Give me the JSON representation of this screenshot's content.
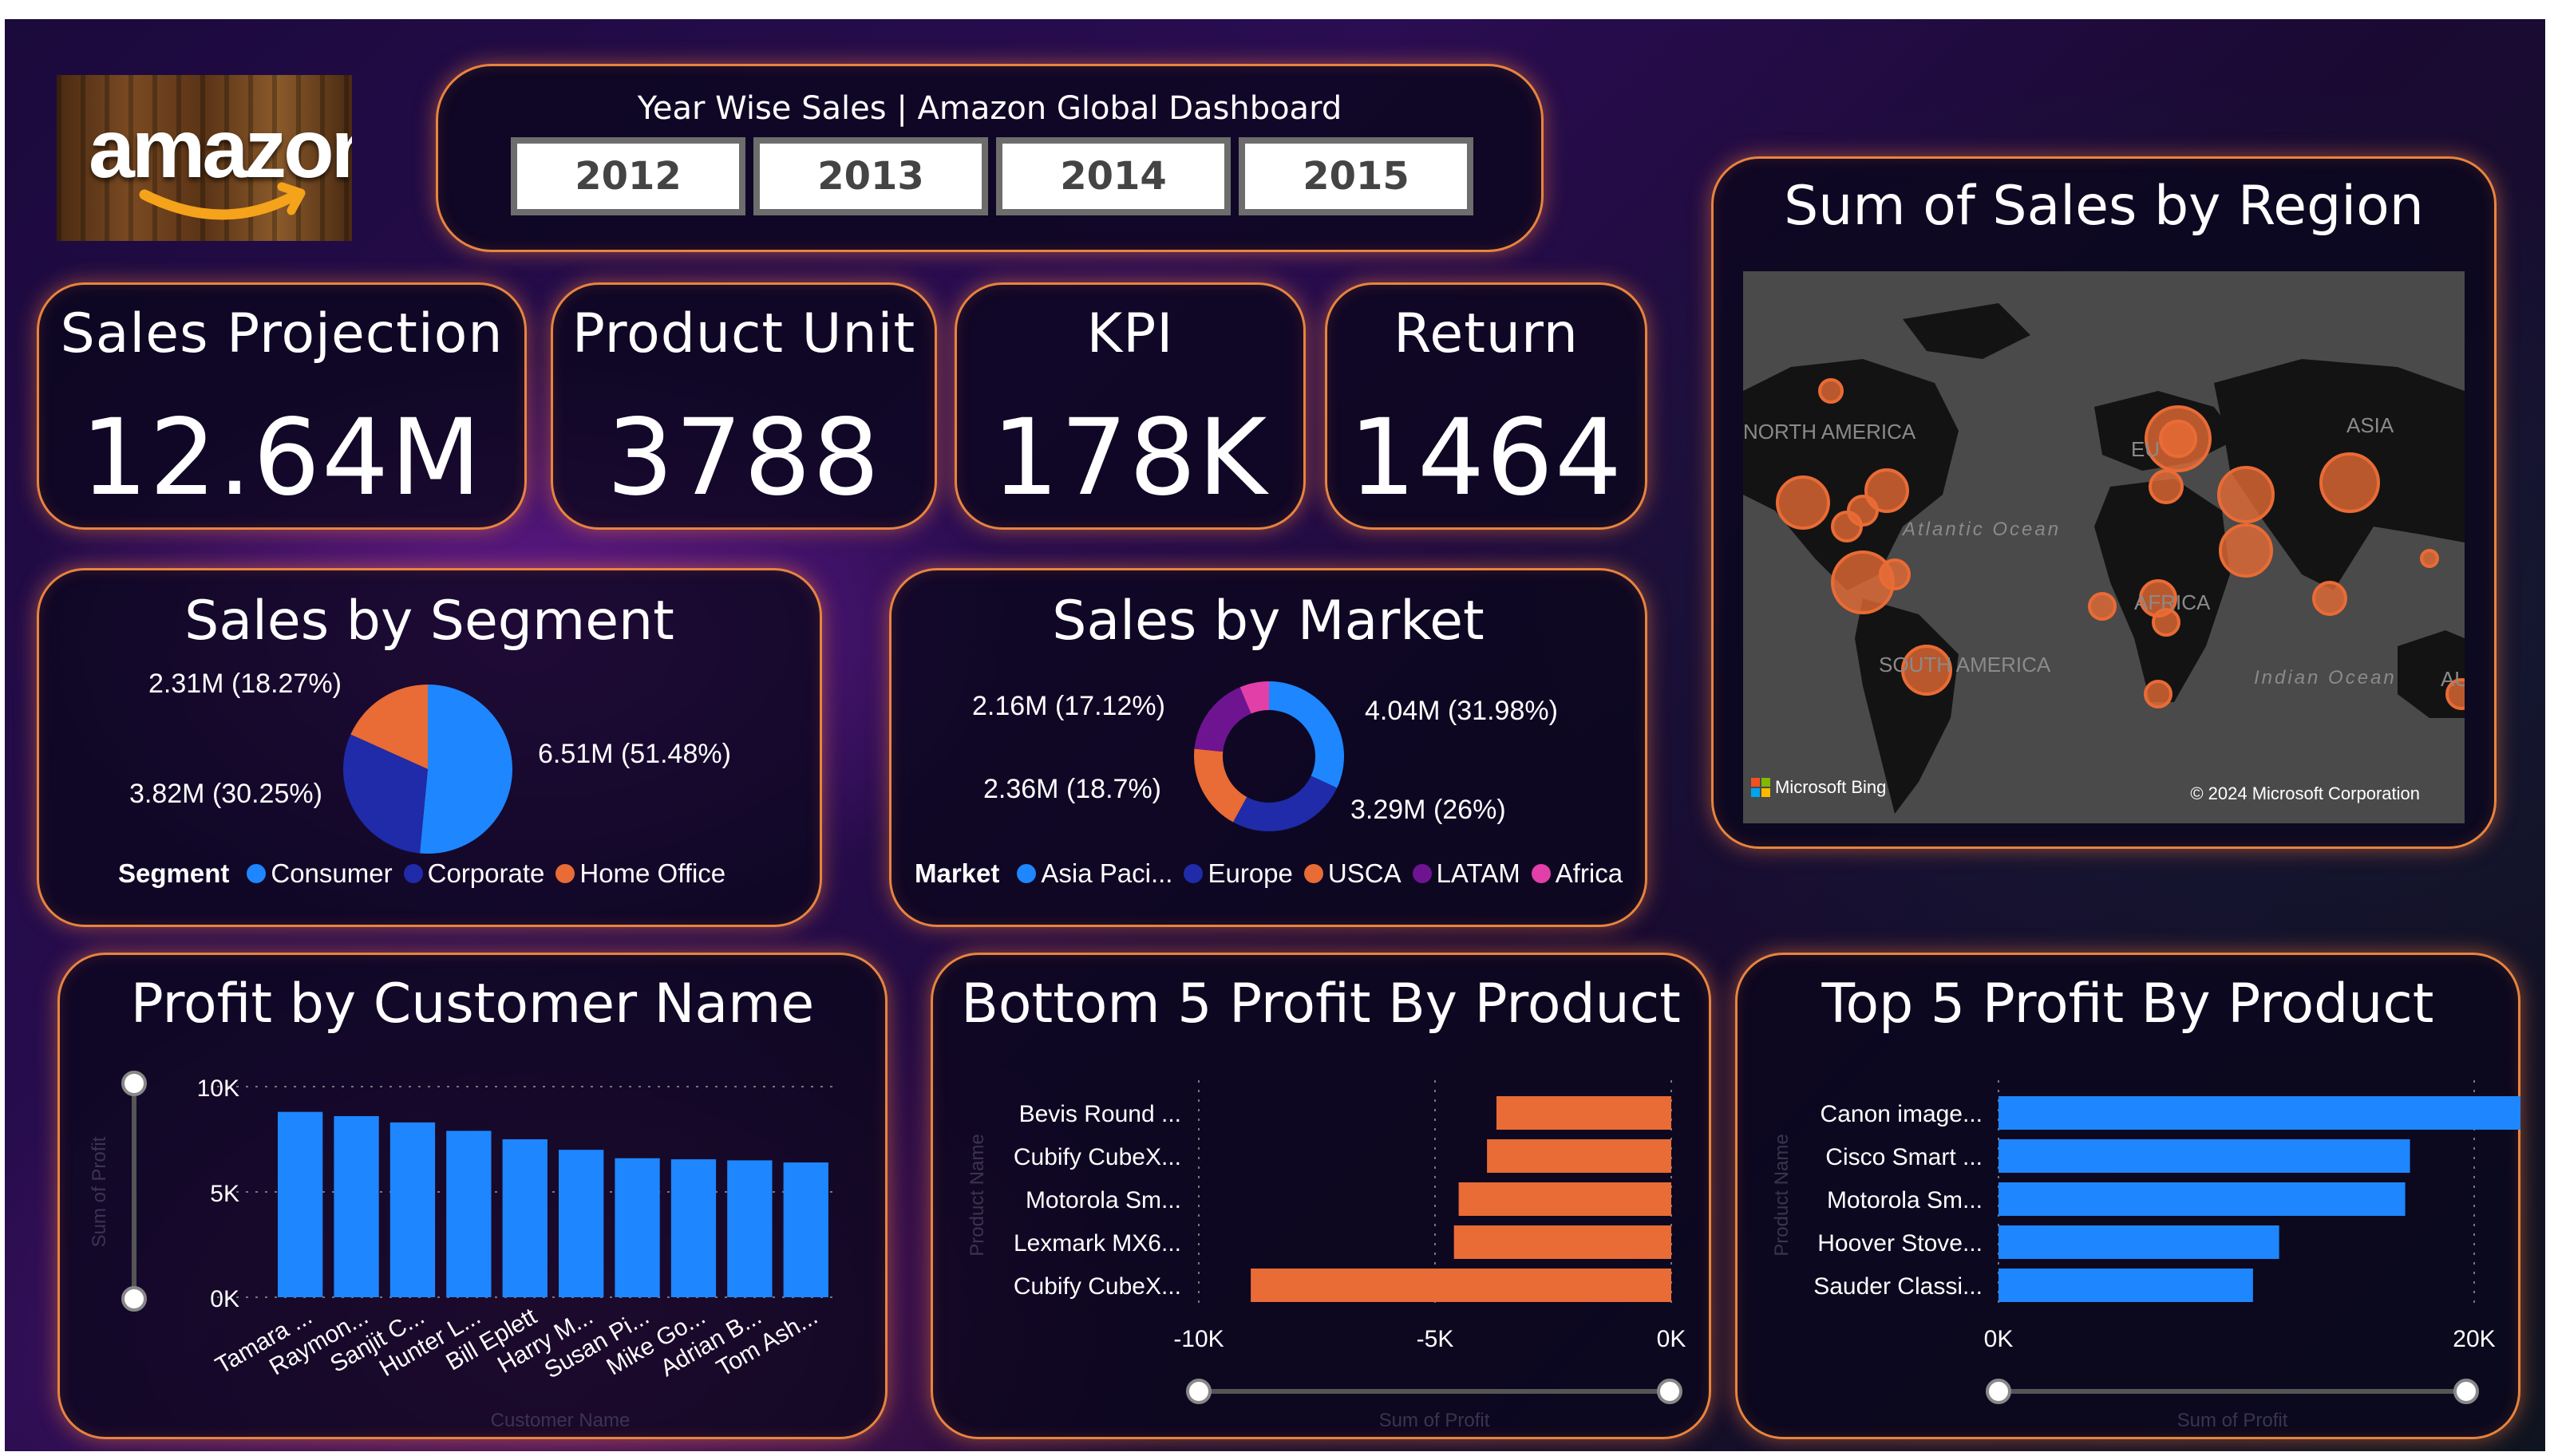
{
  "header": {
    "title": "Year Wise Sales | Amazon Global Dashboard",
    "years": [
      "2012",
      "2013",
      "2014",
      "2015"
    ]
  },
  "logo": {
    "text": "amazon"
  },
  "kpis": [
    {
      "title": "Sales Projection",
      "value": "12.64M"
    },
    {
      "title": "Product Unit",
      "value": "3788"
    },
    {
      "title": "KPI",
      "value": "178K"
    },
    {
      "title": "Return",
      "value": "1464"
    }
  ],
  "segment": {
    "title": "Sales by Segment",
    "legend_title": "Segment",
    "labels": [
      "6.51M (51.48%)",
      "3.82M (30.25%)",
      "2.31M (18.27%)"
    ],
    "legend": [
      "Consumer",
      "Corporate",
      "Home Office"
    ]
  },
  "market": {
    "title": "Sales by Market",
    "legend_title": "Market",
    "labels": [
      "4.04M (31.98%)",
      "3.29M (26%)",
      "2.36M (18.7%)",
      "2.16M (17.12%)"
    ],
    "legend": [
      "Asia Paci...",
      "Europe",
      "USCA",
      "LATAM",
      "Africa"
    ]
  },
  "map": {
    "title": "Sum of Sales by Region",
    "labels": [
      "NORTH AMERICA",
      "EU",
      "ASIA",
      "Atlantic Ocean",
      "AFRICA",
      "SOUTH AMERICA",
      "Indian Ocean",
      "AU"
    ],
    "attribution_left": "Microsoft Bing",
    "attribution_right": "© 2024 Microsoft Corporation"
  },
  "customer": {
    "title": "Profit by Customer Name",
    "xlabel": "Customer Name",
    "ylabel": "Sum of Profit",
    "ticks": [
      "10K",
      "5K",
      "0K"
    ]
  },
  "bottom5": {
    "title": "Bottom 5 Profit By Product",
    "xlabel": "Sum of Profit",
    "ylabel": "Product Name",
    "ticks": [
      "-10K",
      "-5K",
      "0K"
    ]
  },
  "top5": {
    "title": "Top 5 Profit By Product",
    "xlabel": "Sum of Profit",
    "ylabel": "Product Name",
    "ticks": [
      "0K",
      "20K"
    ]
  },
  "colors": {
    "blue": "#1e86ff",
    "navy": "#1f2ba8",
    "orange": "#e96b35",
    "purple": "#6e1491",
    "pink": "#e23fa9",
    "panel_border": "#e8843e"
  },
  "chart_data": [
    {
      "type": "pie",
      "title": "Sales by Segment",
      "categories": [
        "Consumer",
        "Corporate",
        "Home Office"
      ],
      "values": [
        6.51,
        3.82,
        2.31
      ],
      "percentages": [
        51.48,
        30.25,
        18.27
      ],
      "legend": "bottom"
    },
    {
      "type": "pie",
      "title": "Sales by Market",
      "categories": [
        "Asia Paci...",
        "Europe",
        "USCA",
        "LATAM",
        "Africa"
      ],
      "values": [
        4.04,
        3.29,
        2.36,
        2.16,
        0.8
      ],
      "percentages": [
        31.98,
        26,
        18.7,
        17.12,
        6.2
      ],
      "legend": "bottom"
    },
    {
      "type": "bar",
      "title": "Profit by Customer Name",
      "categories": [
        "Tamara ...",
        "Raymon...",
        "Sanjit C...",
        "Hunter L...",
        "Bill Eplett",
        "Harry M...",
        "Susan Pi...",
        "Mike Go...",
        "Adrian B...",
        "Tom Ash..."
      ],
      "values": [
        8800,
        8600,
        8300,
        7900,
        7500,
        7000,
        6600,
        6550,
        6500,
        6400
      ],
      "xlabel": "Customer Name",
      "ylabel": "Sum of Profit",
      "ylim": [
        0,
        10000
      ],
      "grid": true
    },
    {
      "type": "bar",
      "orientation": "horizontal",
      "title": "Bottom 5 Profit By Product",
      "categories": [
        "Bevis Round ...",
        "Cubify CubeX...",
        "Motorola Sm...",
        "Lexmark MX6...",
        "Cubify CubeX..."
      ],
      "values": [
        -3700,
        -3900,
        -4500,
        -4600,
        -8900
      ],
      "xlabel": "Sum of Profit",
      "ylabel": "Product Name",
      "xlim": [
        -10000,
        0
      ],
      "grid": true
    },
    {
      "type": "bar",
      "orientation": "horizontal",
      "title": "Top 5 Profit By Product",
      "categories": [
        "Canon image...",
        "Cisco Smart ...",
        "Motorola Sm...",
        "Hoover Stove...",
        "Sauder Classi..."
      ],
      "values": [
        25200,
        17300,
        17100,
        11800,
        10700
      ],
      "xlabel": "Sum of Profit",
      "ylabel": "Product Name",
      "xlim": [
        0,
        30000
      ],
      "grid": true
    }
  ]
}
